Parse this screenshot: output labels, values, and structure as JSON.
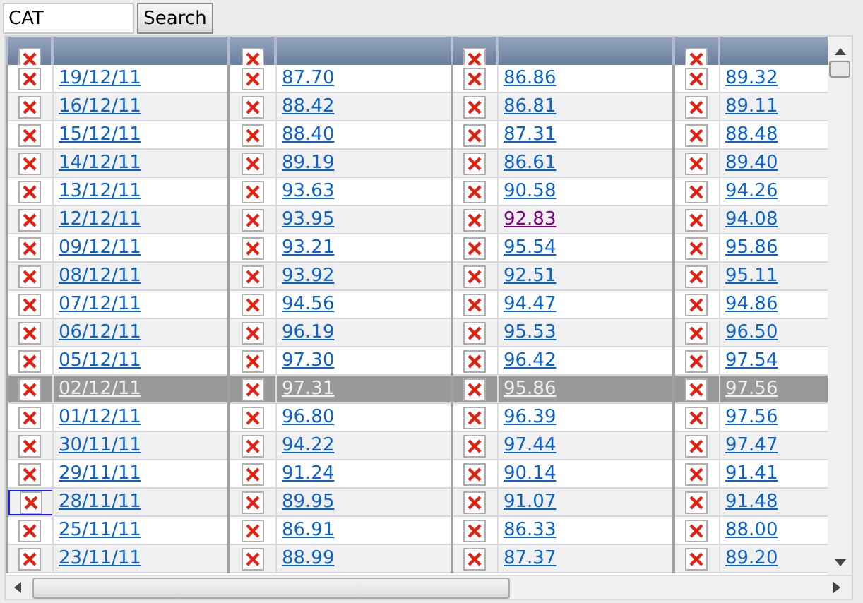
{
  "search": {
    "value": "CAT",
    "button": "Search"
  },
  "rows": [
    {
      "date": "19/12/11",
      "selected": false,
      "focused": false,
      "cells": [
        {
          "text": "87.70",
          "visited": false
        },
        {
          "text": "86.86",
          "visited": false
        },
        {
          "text": "89.32",
          "visited": false
        }
      ]
    },
    {
      "date": "16/12/11",
      "selected": false,
      "focused": false,
      "cells": [
        {
          "text": "88.42",
          "visited": false
        },
        {
          "text": "86.81",
          "visited": false
        },
        {
          "text": "89.11",
          "visited": false
        }
      ]
    },
    {
      "date": "15/12/11",
      "selected": false,
      "focused": false,
      "cells": [
        {
          "text": "88.40",
          "visited": false
        },
        {
          "text": "87.31",
          "visited": false
        },
        {
          "text": "88.48",
          "visited": false
        }
      ]
    },
    {
      "date": "14/12/11",
      "selected": false,
      "focused": false,
      "cells": [
        {
          "text": "89.19",
          "visited": false
        },
        {
          "text": "86.61",
          "visited": false
        },
        {
          "text": "89.40",
          "visited": false
        }
      ]
    },
    {
      "date": "13/12/11",
      "selected": false,
      "focused": false,
      "cells": [
        {
          "text": "93.63",
          "visited": false
        },
        {
          "text": "90.58",
          "visited": false
        },
        {
          "text": "94.26",
          "visited": false
        }
      ]
    },
    {
      "date": "12/12/11",
      "selected": false,
      "focused": false,
      "cells": [
        {
          "text": "93.95",
          "visited": false
        },
        {
          "text": "92.83",
          "visited": true
        },
        {
          "text": "94.08",
          "visited": false
        }
      ]
    },
    {
      "date": "09/12/11",
      "selected": false,
      "focused": false,
      "cells": [
        {
          "text": "93.21",
          "visited": false
        },
        {
          "text": "95.54",
          "visited": false
        },
        {
          "text": "95.86",
          "visited": false
        }
      ]
    },
    {
      "date": "08/12/11",
      "selected": false,
      "focused": false,
      "cells": [
        {
          "text": "93.92",
          "visited": false
        },
        {
          "text": "92.51",
          "visited": false
        },
        {
          "text": "95.11",
          "visited": false
        }
      ]
    },
    {
      "date": "07/12/11",
      "selected": false,
      "focused": false,
      "cells": [
        {
          "text": "94.56",
          "visited": false
        },
        {
          "text": "94.47",
          "visited": false
        },
        {
          "text": "94.86",
          "visited": false
        }
      ]
    },
    {
      "date": "06/12/11",
      "selected": false,
      "focused": false,
      "cells": [
        {
          "text": "96.19",
          "visited": false
        },
        {
          "text": "95.53",
          "visited": false
        },
        {
          "text": "96.50",
          "visited": false
        }
      ]
    },
    {
      "date": "05/12/11",
      "selected": false,
      "focused": false,
      "cells": [
        {
          "text": "97.30",
          "visited": false
        },
        {
          "text": "96.42",
          "visited": false
        },
        {
          "text": "97.54",
          "visited": false
        }
      ]
    },
    {
      "date": "02/12/11",
      "selected": true,
      "focused": false,
      "cells": [
        {
          "text": "97.31",
          "visited": false
        },
        {
          "text": "95.86",
          "visited": false
        },
        {
          "text": "97.56",
          "visited": false
        }
      ]
    },
    {
      "date": "01/12/11",
      "selected": false,
      "focused": false,
      "cells": [
        {
          "text": "96.80",
          "visited": false
        },
        {
          "text": "96.39",
          "visited": false
        },
        {
          "text": "97.56",
          "visited": false
        }
      ]
    },
    {
      "date": "30/11/11",
      "selected": false,
      "focused": false,
      "cells": [
        {
          "text": "94.22",
          "visited": false
        },
        {
          "text": "97.44",
          "visited": false
        },
        {
          "text": "97.47",
          "visited": false
        }
      ]
    },
    {
      "date": "29/11/11",
      "selected": false,
      "focused": false,
      "cells": [
        {
          "text": "91.24",
          "visited": false
        },
        {
          "text": "90.14",
          "visited": false
        },
        {
          "text": "91.41",
          "visited": false
        }
      ]
    },
    {
      "date": "28/11/11",
      "selected": false,
      "focused": true,
      "cells": [
        {
          "text": "89.95",
          "visited": false
        },
        {
          "text": "91.07",
          "visited": false
        },
        {
          "text": "91.48",
          "visited": false
        }
      ]
    },
    {
      "date": "25/11/11",
      "selected": false,
      "focused": false,
      "cells": [
        {
          "text": "86.91",
          "visited": false
        },
        {
          "text": "86.33",
          "visited": false
        },
        {
          "text": "88.00",
          "visited": false
        }
      ]
    },
    {
      "date": "23/11/11",
      "selected": false,
      "focused": false,
      "cells": [
        {
          "text": "88.99",
          "visited": false
        },
        {
          "text": "87.37",
          "visited": false
        },
        {
          "text": "89.20",
          "visited": false
        }
      ]
    }
  ]
}
